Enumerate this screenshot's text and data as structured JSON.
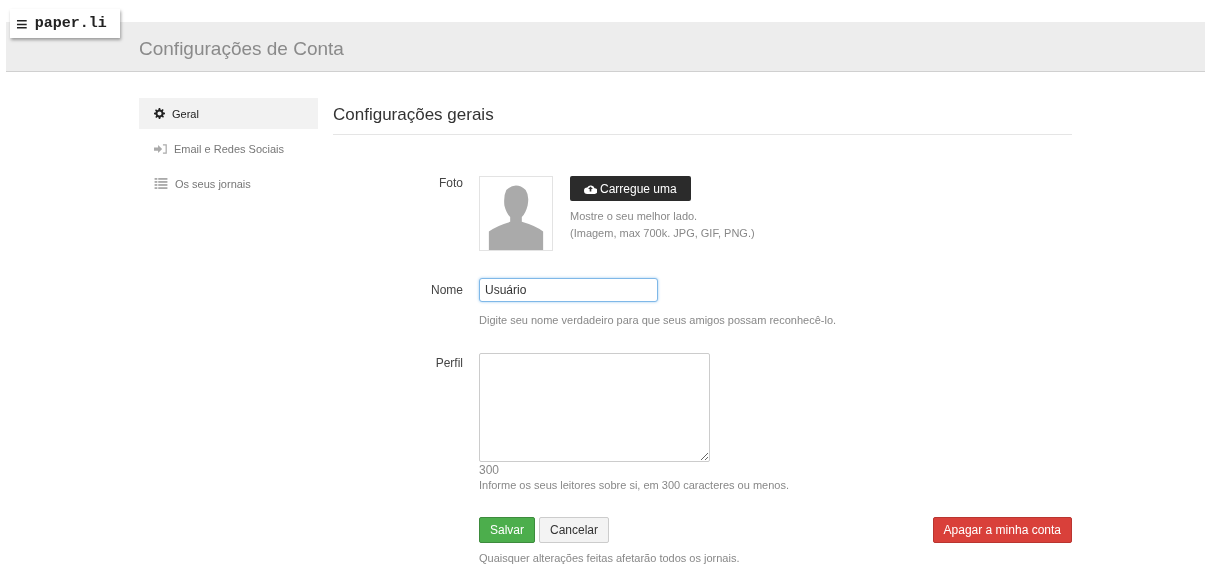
{
  "logo": {
    "menu_icon": "≡",
    "text": "paper.li"
  },
  "header": {
    "title": "Configurações de Conta"
  },
  "sidebar": {
    "items": [
      {
        "label": "Geral",
        "kind": "gear",
        "selected": true
      },
      {
        "label": "Email e Redes Sociais",
        "kind": "signin",
        "selected": false
      },
      {
        "label": "Os seus jornais",
        "kind": "list",
        "selected": false
      }
    ]
  },
  "section": {
    "title": "Configurações gerais"
  },
  "photo": {
    "label": "Foto",
    "upload_button": "Carregue uma",
    "hint_1": "Mostre o seu melhor lado.",
    "hint_2": "(Imagem, max 700k. JPG, GIF, PNG.)"
  },
  "name": {
    "label": "Nome",
    "value": "Usuário",
    "hint": "Digite seu nome verdadeiro para que seus amigos possam reconhecê-lo."
  },
  "profile": {
    "label": "Perfil",
    "counter": "300",
    "hint": "Informe os seus leitores sobre si, em 300 caracteres ou menos."
  },
  "buttons": {
    "save": "Salvar",
    "cancel": "Cancelar",
    "delete": "Apagar a minha conta"
  },
  "footer_note": "Quaisquer alterações feitas afetarão todos os jornais."
}
